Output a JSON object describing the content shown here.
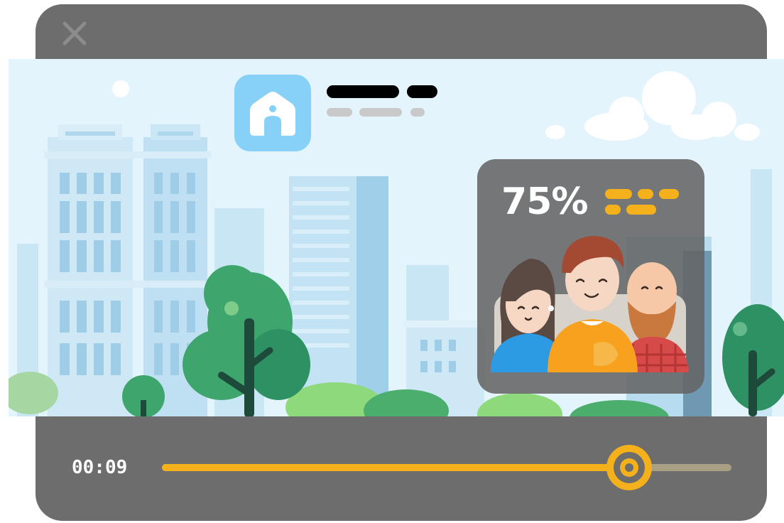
{
  "player": {
    "time": "00:09",
    "progress": 0.82
  },
  "stat_card": {
    "percent": "75%"
  },
  "colors": {
    "frame": "#6d6d6d",
    "accent": "#f5b11b",
    "track": "#a99f84",
    "sky": "#e3f4fc",
    "app_icon": "#87d1f8"
  },
  "icons": [
    "close-icon",
    "home-app-icon",
    "seek-knob-icon"
  ]
}
